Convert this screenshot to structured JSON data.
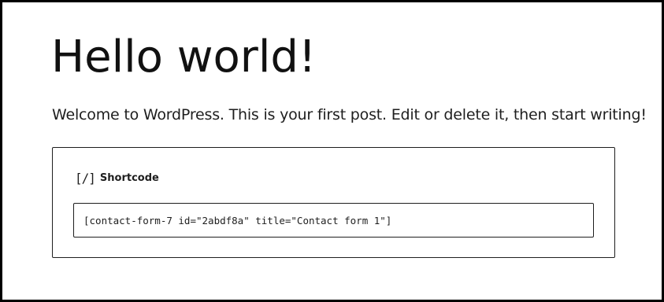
{
  "post": {
    "title": "Hello world!",
    "paragraph": "Welcome to WordPress. This is your first post. Edit or delete it, then start writing!"
  },
  "shortcode_block": {
    "icon": "shortcode-icon",
    "icon_glyph": "[/]",
    "label": "Shortcode",
    "value": "[contact-form-7 id=\"2abdf8a\" title=\"Contact form 1\"]"
  }
}
